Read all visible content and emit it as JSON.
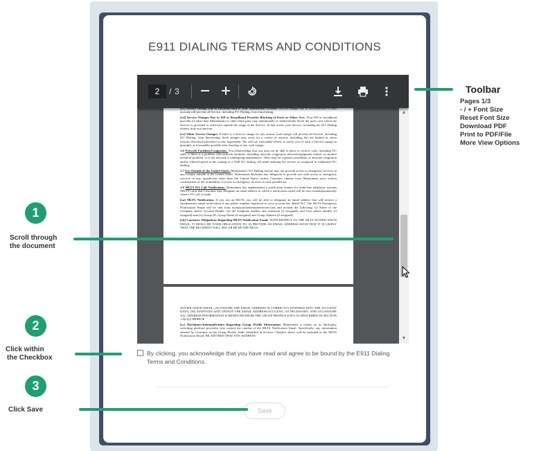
{
  "dialog": {
    "title": "E911 DIALING TERMS AND CONDITIONS"
  },
  "pdf_viewer": {
    "current_page": "2",
    "page_separator": "/",
    "total_pages": "3",
    "zoom_out_icon": "minus-icon",
    "zoom_in_icon": "plus-icon",
    "rotate_icon": "rotate-icon",
    "download_icon": "download-icon",
    "print_icon": "print-icon",
    "more_icon": "more-vert-icon",
    "page1_paragraphs": [
      {
        "label": "[i.c]",
        "heading": "Service Outage Due to Disconnection of Your Momentum Account.",
        "body": "Service outages due to disconnection of your account will prevent all Service, including 911 Dialing, from functioning."
      },
      {
        "label": "[i.d]",
        "heading": "Service Outages Due to ISP or Broadband Provider Blocking of Ports or Other Acts.",
        "body": "Your ISP or broadband provider (if other than Momentum) or other third party may intentionally or inadvertently block the ports over which the Service is provided or otherwise impede the usage of the Service. In that event, your Service, including the 911 Dialing feature, may not function."
      },
      {
        "label": "[i.e]",
        "heading": "Other Service Outages.",
        "body": "If there is a Service outage for any reason, such outage will prevent all Service, including 911 Dialing, from functioning. Such outages may occur for a variety of reasons, including, but not limited to, those reasons described elsewhere in this Agreement. We will use reasonable efforts to notify you of such a Service outage as promptly as reasonably possible after learning of any such outage."
      },
      {
        "label": "1.6",
        "heading": "Network Facilities/Congestion.",
        "body": "You acknowledge that you may not be able to place or receive calls, including 911 calls, if there is a problem with network facilities, including network congestion, network/equipment failure, or another technical problem, or if the network is undergoing maintenance. There may be a greater possibility of network congestion and/or reduced speed in the routing of a VoIP 911 dialing call made utilizing the service as compared to traditional 911 dialing."
      },
      {
        "label": "1.7",
        "heading": "Use Outside of the United States.",
        "body": "Momentum's 911 Dialing feature may not provide access to emergency services in any country outside of the United States. Momentum disclaims any obligation to provide you with access to emergency services in any jurisdiction other than the United States, unless Customer obtains from Momentum prior written confirmation of the availability of access to emergency services in such jurisdiction."
      },
      {
        "label": "1.8",
        "heading": "MLTS 911 Call Notification.",
        "body": "Momentum has implemented a notification feature for multi-line telephone systems (MLTS) such that Customer may designate an email address to which a notification email will be sent contemporaneously when a 911 call is made."
      },
      {
        "label": "[i.a]",
        "heading": "MLTS Notification.",
        "body": "If you use an MLTS, you will be able to designate an email address that will receive a simultaneous email notification if any phone number registered to your account has dialed 911. The MLTS Emergency Notification Email will be sent from noreply@momentumtelecom.com and include the following: (i) Name of the Company and/or Account Holder; (ii) the telephone number and extension (if assigned); and User phone number (if assigned) and (iv) Group ID, Group Name (if assigned) and Group Address (if assigned)."
      },
      {
        "label": "[i.b]",
        "heading": "Customer Obligations Regarding MLTS Notification Email.",
        "body": "WITH RESPECT TO THE MLTS NOTIFICATION EMAIL, IT SHALL BE YOUR OBLIGATION TO: (I) PROVIDE AN EMAIL ADDRESS SUCH THAT IT IS LIKELY THAT THE RECIPIENT WILL SEE OR HEAR THE MLTS"
      }
    ],
    "page2_paragraphs": [
      {
        "label": "",
        "heading": "",
        "body": "NOTIFICATION EMAIL; (II) ENSURE THE EMAIL ADDRESS IS CORRECTLY ENTERED INTO THE ACCOUNT DATA; (III) MAINTAIN AND UPDATE THE EMAIL ADDRESS/ACCOUNT, AS NECESSARY; AND (IV) ENSURE ALL ADDRESS INFORMATION IS REMOVED FROM THE GROUP PROFILE DATA AS DESCRIBED IN SECTION 1.8(c)(v) HEREOF."
      },
      {
        "label": "[i.c]",
        "heading": "Disclaimer/Indemnification Regarding Group Profile Information.",
        "body": "Momentum is reliant on its third-party switching platform providers who control the content of the MLTS Notification Email. Specifically, any information entered by Customer in the Group Profile fields identified in Section 1.8(a)(iv) above will be included in the MLTS Notification Email. BE ADVISED THAT ANY ADDRESS"
      }
    ]
  },
  "agreement": {
    "checked": false,
    "text": "By clicking, you acknowledge that you have read and agree to be bound by the E911 Dialing Terms and Conditions."
  },
  "save_button": {
    "label": "Save"
  },
  "annotations": {
    "accent_color": "#1f9e70",
    "toolbar": {
      "title": "Toolbar",
      "items": [
        "Pages 1/3",
        "- / + Font Size",
        "Reset Font Size",
        "Download PDF",
        "Print to PDF/File",
        "More View Options"
      ]
    },
    "steps": [
      {
        "number": "1",
        "label_line1": "Scroll through",
        "label_line2": "the document"
      },
      {
        "number": "2",
        "label_line1": "Click within",
        "label_line2": "the Checkbox"
      },
      {
        "number": "3",
        "label_line1": "Click Save",
        "label_line2": ""
      }
    ]
  }
}
